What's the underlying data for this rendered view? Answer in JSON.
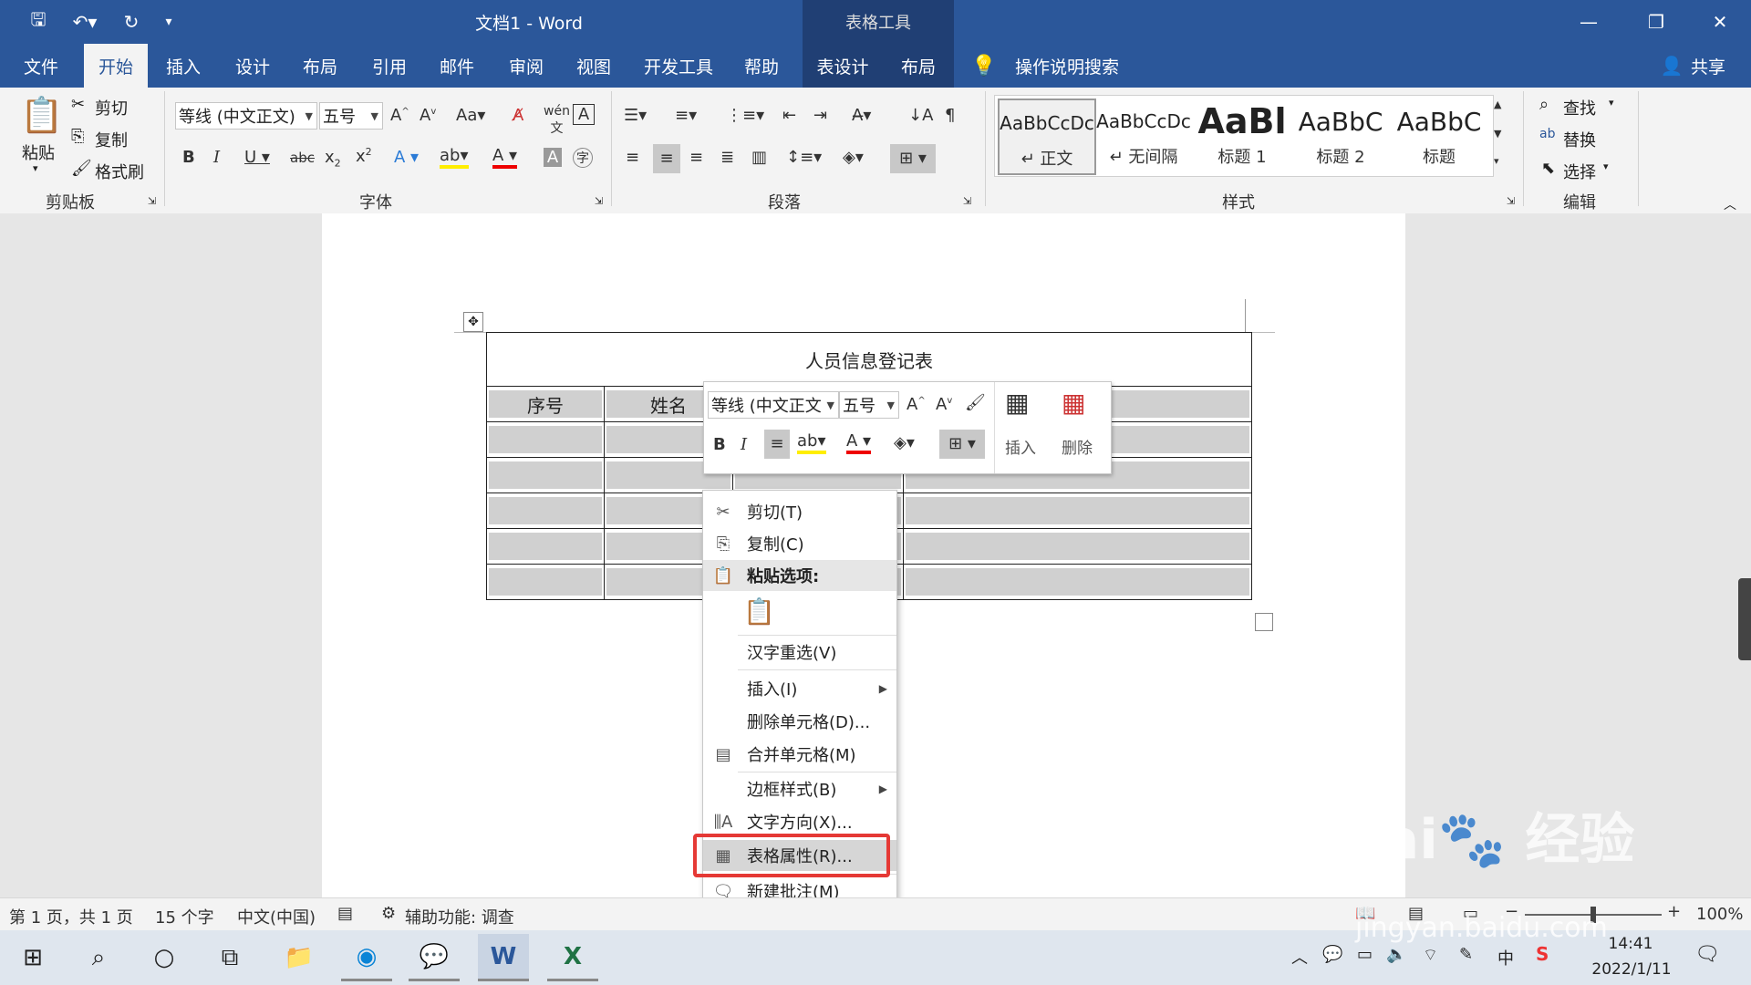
{
  "titlebar": {
    "doc_title": "文档1  -  Word",
    "context_group": "表格工具",
    "share": "共享",
    "tell_me": "操作说明搜索"
  },
  "tabs": [
    "文件",
    "开始",
    "插入",
    "设计",
    "布局",
    "引用",
    "邮件",
    "审阅",
    "视图",
    "开发工具",
    "帮助",
    "表设计",
    "布局"
  ],
  "active_tab": "开始",
  "ribbon": {
    "clipboard": {
      "paste": "粘贴",
      "cut": "剪切",
      "copy": "复制",
      "format_painter": "格式刷",
      "label": "剪贴板"
    },
    "font": {
      "font_name": "等线 (中文正文)",
      "font_size": "五号",
      "label": "字体"
    },
    "paragraph": {
      "label": "段落"
    },
    "styles": {
      "label": "样式",
      "items": [
        {
          "sample": "AaBbCcDc",
          "name": "↵ 正文"
        },
        {
          "sample": "AaBbCcDc",
          "name": "↵ 无间隔"
        },
        {
          "sample": "AaBl",
          "name": "标题 1"
        },
        {
          "sample": "AaBbC",
          "name": "标题 2"
        },
        {
          "sample": "AaBbC",
          "name": "标题"
        }
      ]
    },
    "editing": {
      "find": "查找",
      "replace": "替换",
      "select": "选择",
      "label": "编辑"
    }
  },
  "document": {
    "table_title": "人员信息登记表",
    "headers": [
      "序号",
      "姓名"
    ]
  },
  "mini_toolbar": {
    "font_name": "等线 (中文正文",
    "font_size": "五号",
    "insert": "插入",
    "delete": "删除"
  },
  "context_menu": {
    "cut": "剪切(T)",
    "copy": "复制(C)",
    "paste_options": "粘贴选项:",
    "reconvert": "汉字重选(V)",
    "insert": "插入(I)",
    "delete_cells": "删除单元格(D)...",
    "merge_cells": "合并单元格(M)",
    "border_styles": "边框样式(B)",
    "text_direction": "文字方向(X)...",
    "table_properties": "表格属性(R)...",
    "new_comment": "新建批注(M)"
  },
  "statusbar": {
    "page": "第 1 页，共 1 页",
    "words": "15 个字",
    "language": "中文(中国)",
    "accessibility": "辅助功能: 调查",
    "zoom": "100%"
  },
  "taskbar": {
    "time": "14:41",
    "date": "2022/1/11",
    "ime": "中"
  },
  "watermark": {
    "text": "jingyan.baidu.com"
  },
  "colors": {
    "brand": "#2b579a",
    "highlight_box": "#e53935"
  }
}
